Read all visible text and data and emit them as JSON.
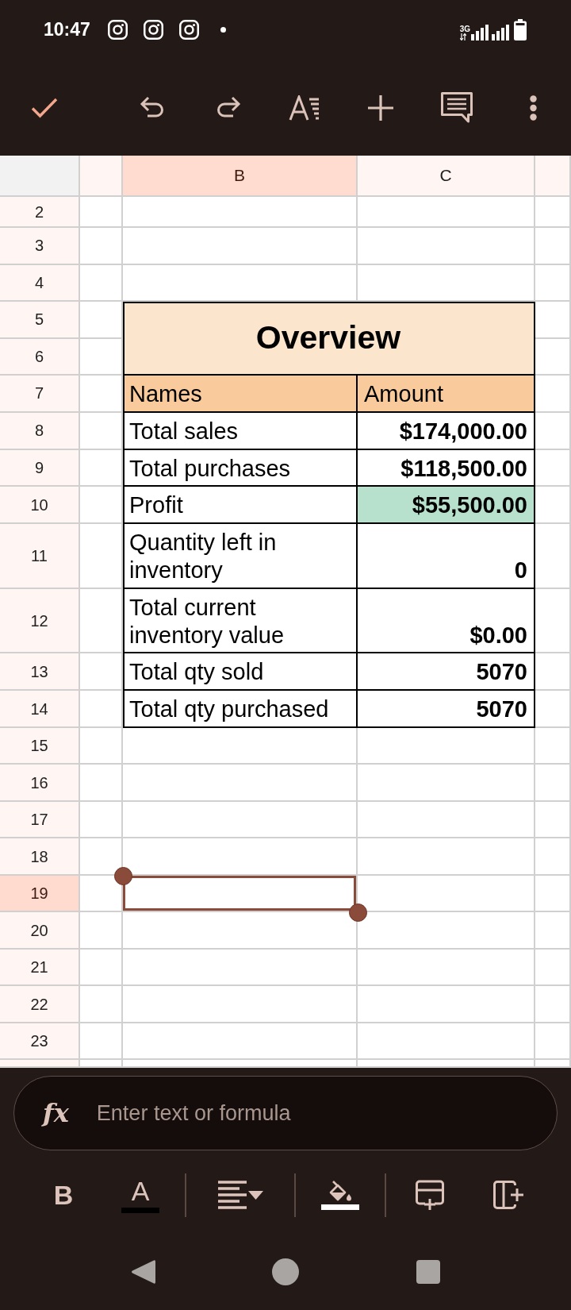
{
  "status_bar": {
    "time": "10:47",
    "network": "3G"
  },
  "sheet": {
    "columns": [
      {
        "label": "B",
        "selected": true
      },
      {
        "label": "C",
        "selected": false
      }
    ],
    "rows": [
      {
        "number": "2",
        "selected": false
      },
      {
        "number": "3",
        "selected": false
      },
      {
        "number": "4",
        "selected": false
      },
      {
        "number": "5",
        "selected": false,
        "cells": [
          {
            "kind": "title",
            "text": "Overview",
            "color": "#fce5cd"
          }
        ]
      },
      {
        "number": "6",
        "selected": false
      },
      {
        "number": "7",
        "selected": false,
        "cells": [
          {
            "kind": "header",
            "text": "Names",
            "color": "#f9cb9c"
          },
          {
            "kind": "header",
            "text": "Amount",
            "color": "#f9cb9c"
          }
        ]
      },
      {
        "number": "8",
        "selected": false,
        "cells": [
          {
            "kind": "label",
            "text": "Total sales"
          },
          {
            "kind": "amount",
            "text": "$174,000.00"
          }
        ]
      },
      {
        "number": "9",
        "selected": false,
        "cells": [
          {
            "kind": "label",
            "text": "Total purchases"
          },
          {
            "kind": "amount",
            "text": "$118,500.00"
          }
        ]
      },
      {
        "number": "10",
        "selected": false,
        "cells": [
          {
            "kind": "label",
            "text": "Profit"
          },
          {
            "kind": "amount",
            "text": "$55,500.00",
            "color": "#b7e1cd"
          }
        ]
      },
      {
        "number": "11",
        "selected": false,
        "cells": [
          {
            "kind": "label",
            "text": "Quantity left in inventory"
          },
          {
            "kind": "amount",
            "text": "0"
          }
        ]
      },
      {
        "number": "12",
        "selected": false,
        "cells": [
          {
            "kind": "label",
            "text": "Total current inventory value"
          },
          {
            "kind": "amount",
            "text": "$0.00"
          }
        ]
      },
      {
        "number": "13",
        "selected": false,
        "cells": [
          {
            "kind": "label",
            "text": "Total qty sold"
          },
          {
            "kind": "amount",
            "text": "5070"
          }
        ]
      },
      {
        "number": "14",
        "selected": false,
        "cells": [
          {
            "kind": "label",
            "text": "Total qty purchased"
          },
          {
            "kind": "amount",
            "text": "5070"
          }
        ]
      },
      {
        "number": "15",
        "selected": false
      },
      {
        "number": "16",
        "selected": false
      },
      {
        "number": "17",
        "selected": false
      },
      {
        "number": "18",
        "selected": false
      },
      {
        "number": "19",
        "selected": true
      },
      {
        "number": "20",
        "selected": false
      },
      {
        "number": "21",
        "selected": false
      },
      {
        "number": "22",
        "selected": false
      },
      {
        "number": "23",
        "selected": false
      }
    ]
  },
  "formula_bar": {
    "label": "fx",
    "placeholder": "Enter text or formula"
  },
  "format_toolbar": {
    "bold": {
      "label": "B"
    },
    "text_color": {
      "label": "A",
      "color": "#000000"
    },
    "fill_color": {
      "color": "#ffffff"
    }
  }
}
